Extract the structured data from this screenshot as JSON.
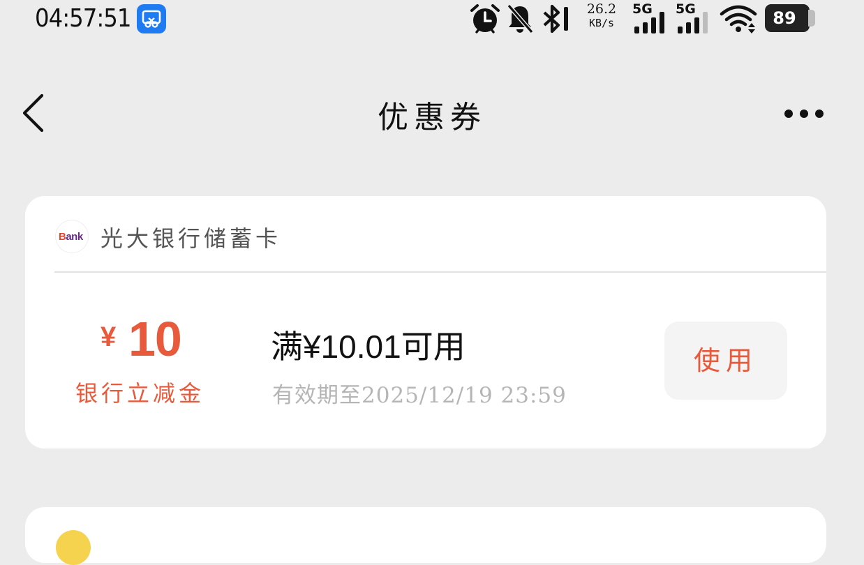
{
  "status_bar": {
    "time": "04:57:51",
    "network_speed_value": "26.2",
    "network_speed_unit": "KB/s",
    "sim1_label": "5G",
    "sim2_label": "5G",
    "battery": "89",
    "icons": [
      "screenshot-app-icon",
      "alarm-icon",
      "mute-bell-icon",
      "bluetooth-icon",
      "signal-icon",
      "wifi-icon",
      "battery-icon"
    ]
  },
  "nav": {
    "title": "优惠券",
    "back_icon": "chevron-left-icon",
    "more_icon": "more-dots-icon"
  },
  "coupon": {
    "bank_name": "光大银行储蓄卡",
    "bank_logo_text_b": "B",
    "bank_logo_text_rest": "ank",
    "currency": "¥",
    "amount": "10",
    "type": "银行立减金",
    "condition": "满¥10.01可用",
    "expiry": "有效期至2025/12/19 23:59",
    "use_button": "使用"
  },
  "colors": {
    "accent": "#e85a3c",
    "background": "#ececec",
    "card": "#ffffff",
    "status_blue": "#1e7bf2"
  }
}
